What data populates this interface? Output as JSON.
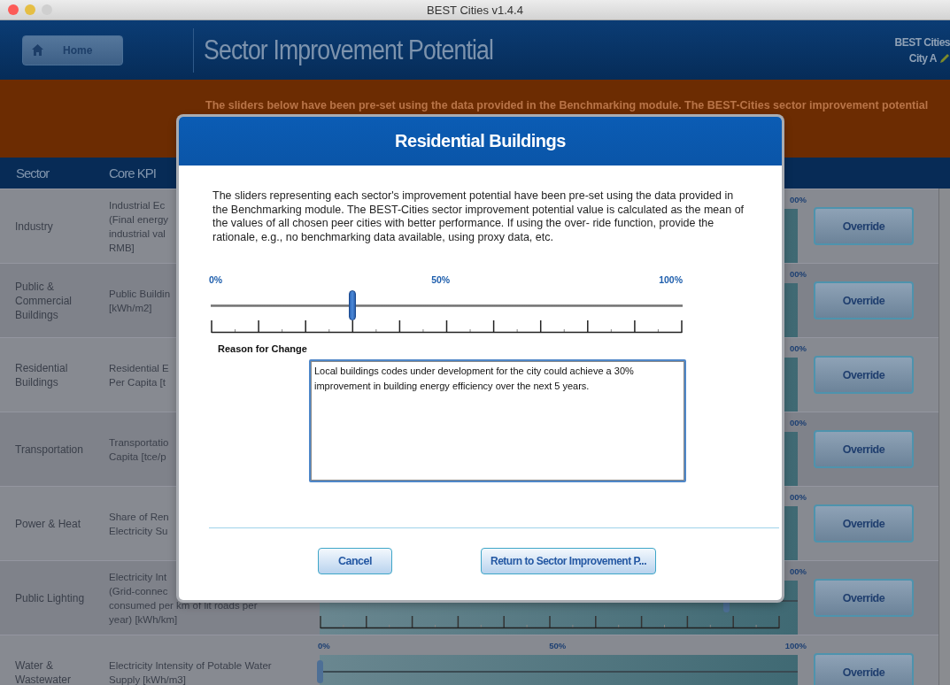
{
  "window": {
    "title": "BEST Cities v1.4.4"
  },
  "header": {
    "home_button": "Home",
    "title": "Sector Improvement Potential",
    "app_name": "BEST Cities",
    "city": "City A"
  },
  "banner": {
    "text": "The sliders below have been pre-set using the data provided in the Benchmarking module. The BEST-Cities sector improvement potential"
  },
  "table": {
    "columns": [
      "Sector",
      "Core KPI"
    ],
    "rows": [
      {
        "sector": "Industry",
        "kpi": "Industrial Ec\n(Final energy\nindustrial val\nRMB]",
        "scale_labels": [
          "00%"
        ],
        "button": "Override"
      },
      {
        "sector": "Public &\nCommercial\nBuildings",
        "kpi": "Public Buildin\n[kWh/m2]",
        "scale_labels": [
          "00%"
        ],
        "button": "Override"
      },
      {
        "sector": "Residential\nBuildings",
        "kpi": "Residential E\nPer Capita [t",
        "scale_labels": [
          "00%"
        ],
        "button": "Override"
      },
      {
        "sector": "Transportation",
        "kpi": "Transportatio\nCapita [tce/p",
        "scale_labels": [
          "00%"
        ],
        "button": "Override"
      },
      {
        "sector": "Power & Heat",
        "kpi": "Share of Ren\nElectricity Su",
        "scale_labels": [
          "00%"
        ],
        "button": "Override"
      },
      {
        "sector": "Public Lighting",
        "kpi": "Electricity Int\n(Grid-connec\nconsumed per km of lit roads per\nyear) [kWh/km]",
        "scale_labels": [
          "00%"
        ],
        "level": 0.85,
        "button": "Override"
      },
      {
        "sector": "Water &\nWastewater",
        "kpi": "Electricity Intensity of Potable Water\nSupply [kWh/m3]",
        "scale_labels": [
          "0%",
          "50%",
          "100%"
        ],
        "level": 0,
        "button": "Override"
      }
    ]
  },
  "dialog": {
    "title": "Residential Buildings",
    "description": "The sliders representing each sector's improvement potential have been pre-set using the data provided in the Benchmarking module. The BEST-Cities sector improvement potential value is calculated as the mean of the values of all chosen peer cities with better performance. If using the over- ride function, provide the rationale, e.g., no benchmarking data available, using proxy data, etc.",
    "scale_labels": [
      "0%",
      "50%",
      "100%"
    ],
    "level": 0.3,
    "reason_label": "Reason for Change",
    "reason": "Local buildings codes under development for the city could achieve a 30% improvement in building energy efficiency over the next 5 years.",
    "buttons": [
      "Cancel",
      "Return to Sector Improvement P..."
    ]
  }
}
